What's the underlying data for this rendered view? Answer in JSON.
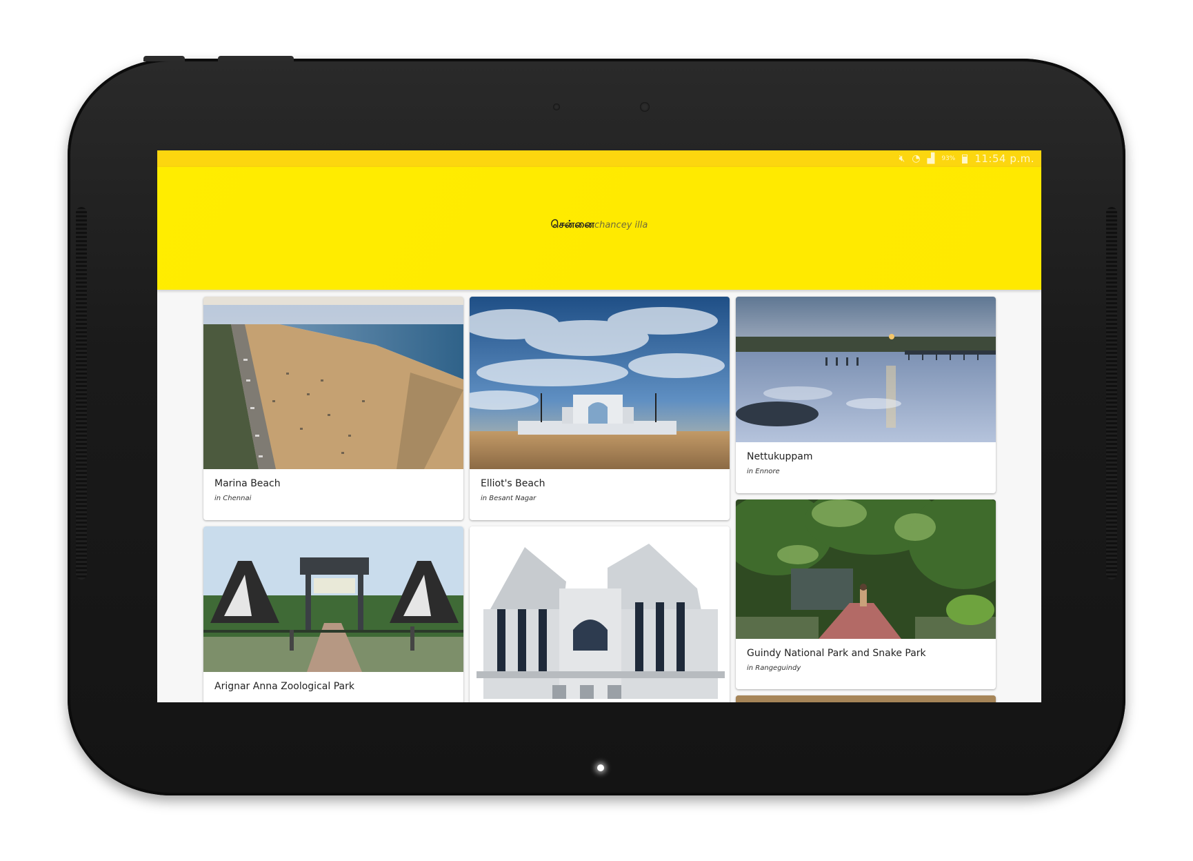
{
  "status_bar": {
    "mute_icon": "mute-icon",
    "wifi_icon": "wifi-icon",
    "signal_icon": "signal-icon",
    "battery_percent": "93%",
    "time": "11:54 p.m."
  },
  "app_bar": {
    "title": "சென்னை",
    "subtitle": "chancey illa",
    "color": "#ffea00"
  },
  "places": [
    {
      "name": "Marina Beach",
      "location": "in Chennai"
    },
    {
      "name": "Elliot's Beach",
      "location": "in Besant Nagar"
    },
    {
      "name": "Nettukuppam",
      "location": "in Ennore"
    },
    {
      "name": "Arignar Anna Zoological Park",
      "location": ""
    },
    {
      "name": "",
      "location": ""
    },
    {
      "name": "Guindy National Park and Snake Park",
      "location": "in Rangeguindy"
    },
    {
      "name": "",
      "location": ""
    }
  ]
}
